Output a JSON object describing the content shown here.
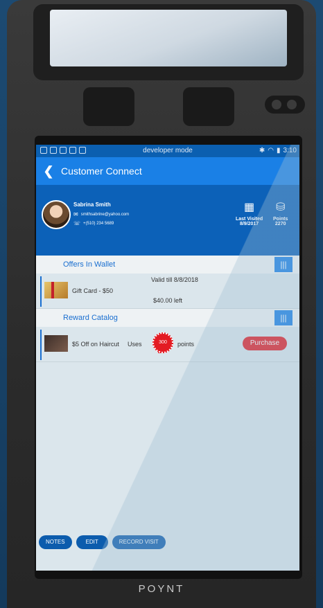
{
  "device": {
    "brand": "POYNT"
  },
  "status_bar": {
    "mode_text": "developer mode",
    "time": "3:10"
  },
  "app_bar": {
    "back_icon": "chevron-left-icon",
    "title": "Customer Connect"
  },
  "customer": {
    "name": "Sabrina Smith",
    "email": "smithsabrine@yahoo.com",
    "phone": "+(510) 234 5689",
    "last_visited_label": "Last Visited",
    "last_visited_value": "8/9/2017",
    "points_label": "Points",
    "points_value": "2270"
  },
  "offers": {
    "header": "Offers In Wallet",
    "items": [
      {
        "title": "Gift Card - $50",
        "valid": "Valid till 8/8/2018",
        "left": "$40.00 left"
      }
    ]
  },
  "rewards": {
    "header": "Reward Catalog",
    "items": [
      {
        "title": "$5 Off on Haircut",
        "uses_label": "Uses",
        "points": "300",
        "points_label": "points",
        "action": "Purchase"
      }
    ]
  },
  "actions": {
    "notes": "NOTES",
    "edit": "EDIT",
    "record_visit": "RECORD VISIT"
  },
  "colors": {
    "primary": "#1a80e6",
    "dark_primary": "#0c61b8",
    "accent_red": "#e31b23"
  }
}
